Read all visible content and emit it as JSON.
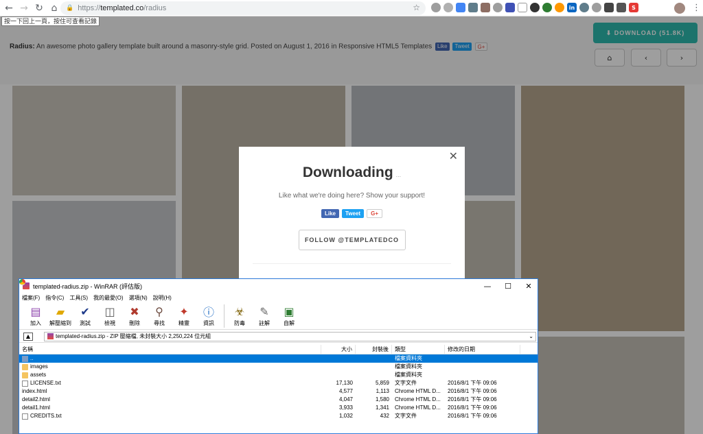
{
  "browser": {
    "url_scheme": "https://",
    "url_host": "templated.co",
    "url_path": "/radius",
    "tooltip": "按一下回上一頁，按住可查看記錄",
    "nav_back": "←",
    "nav_forward": "→",
    "nav_reload": "↻",
    "nav_home": "⌂",
    "star": "☆",
    "lock": "🔒",
    "kebab": "⋮"
  },
  "demo": {
    "name": "Radius:",
    "description": "An awesome photo gallery template built around a masonry-style grid. Posted on August 1, 2016 in Responsive HTML5 Templates",
    "like": "Like",
    "tweet": "Tweet",
    "gplus": "G+",
    "download_label": "⬇ DOWNLOAD (51.8K)",
    "home_icon": "⌂",
    "prev_icon": "‹",
    "next_icon": "›"
  },
  "modal": {
    "close": "✕",
    "title": "Downloading",
    "dots": "...",
    "subtitle": "Like what we're doing here? Show your support!",
    "like": "Like",
    "tweet": "Tweet",
    "gplus": "G+",
    "follow": "FOLLOW @TEMPLATEDCO"
  },
  "winrar": {
    "title": "templated-radius.zip - WinRAR (評估版)",
    "minimize": "—",
    "maximize": "☐",
    "close": "✕",
    "menu": [
      "檔案(F)",
      "指令(C)",
      "工具(S)",
      "我的最愛(O)",
      "選項(N)",
      "說明(H)"
    ],
    "tools": [
      "加入",
      "解壓縮到",
      "測試",
      "檢視",
      "刪除",
      "尋找",
      "精靈",
      "資訊",
      "防毒",
      "註解",
      "自解"
    ],
    "address": "templated-radius.zip - ZIP 壓縮檔, 未封裝大小 2,250,224 位元組",
    "columns": {
      "name": "名稱",
      "size": "大小",
      "packed": "封裝後",
      "type": "類型",
      "modified": "修改的日期"
    },
    "rows": [
      {
        "name": "..",
        "size": "",
        "packed": "",
        "type": "檔案資料夾",
        "modified": ""
      },
      {
        "name": "images",
        "size": "",
        "packed": "",
        "type": "檔案資料夾",
        "modified": ""
      },
      {
        "name": "assets",
        "size": "",
        "packed": "",
        "type": "檔案資料夾",
        "modified": ""
      },
      {
        "name": "LICENSE.txt",
        "size": "17,130",
        "packed": "5,859",
        "type": "文字文件",
        "modified": "2016/8/1 下午 09:06"
      },
      {
        "name": "index.html",
        "size": "4,577",
        "packed": "1,113",
        "type": "Chrome HTML D...",
        "modified": "2016/8/1 下午 09:06"
      },
      {
        "name": "detail2.html",
        "size": "4,047",
        "packed": "1,580",
        "type": "Chrome HTML D...",
        "modified": "2016/8/1 下午 09:06"
      },
      {
        "name": "detail1.html",
        "size": "3,933",
        "packed": "1,341",
        "type": "Chrome HTML D...",
        "modified": "2016/8/1 下午 09:06"
      },
      {
        "name": "CREDITS.txt",
        "size": "1,032",
        "packed": "432",
        "type": "文字文件",
        "modified": "2016/8/1 下午 09:06"
      }
    ]
  }
}
